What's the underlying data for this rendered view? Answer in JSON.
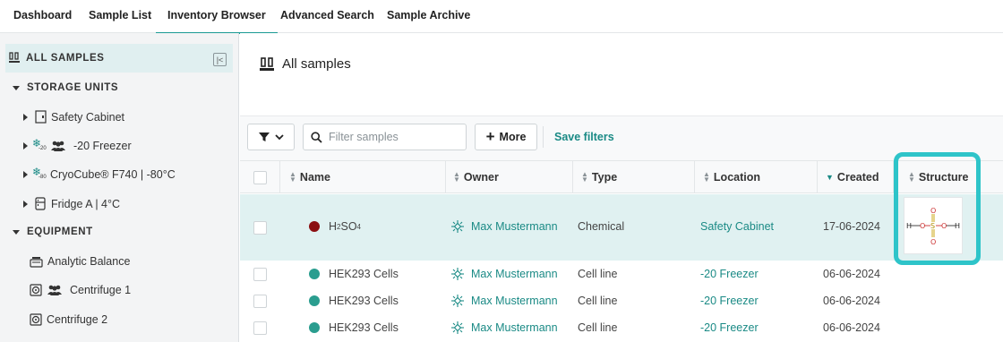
{
  "nav": {
    "tabs": [
      {
        "label": "Dashboard"
      },
      {
        "label": "Sample List"
      },
      {
        "label": "Inventory Browser",
        "active": true
      },
      {
        "label": "Advanced Search"
      },
      {
        "label": "Sample Archive"
      }
    ]
  },
  "sidebar": {
    "all_samples": "ALL SAMPLES",
    "storage_header": "STORAGE UNITS",
    "storage_units": [
      {
        "label": "Safety Cabinet",
        "icon": "cabinet-icon"
      },
      {
        "label": "-20 Freezer",
        "icon": "freezer-minus20-icon",
        "sub": "-20",
        "shared": true
      },
      {
        "label": "CryoCube® F740 | -80°C",
        "icon": "freezer-minus80-icon",
        "sub": "-80"
      },
      {
        "label": "Fridge A | 4°C",
        "icon": "fridge-icon"
      }
    ],
    "equipment_header": "EQUIPMENT",
    "equipment": [
      {
        "label": "Analytic Balance",
        "icon": "balance-icon"
      },
      {
        "label": "Centrifuge 1",
        "icon": "centrifuge-icon",
        "shared": true
      },
      {
        "label": "Centrifuge 2",
        "icon": "centrifuge-icon"
      }
    ]
  },
  "main": {
    "title": "All samples",
    "toolbar": {
      "search_placeholder": "Filter samples",
      "more_label": "More",
      "save_filters": "Save filters"
    },
    "columns": [
      "Name",
      "Owner",
      "Type",
      "Location",
      "Created",
      "Structure"
    ],
    "rows": [
      {
        "name_main": "H",
        "name_sub1": "2",
        "name_mid": "SO",
        "name_sub2": "4",
        "owner": "Max Mustermann",
        "type": "Chemical",
        "location": "Safety Cabinet",
        "created": "17-06-2024",
        "dot_color": "#8b0f12",
        "has_structure": true
      },
      {
        "name": "HEK293 Cells",
        "owner": "Max Mustermann",
        "type": "Cell line",
        "location": "-20 Freezer",
        "created": "06-06-2024",
        "dot_color": "#2a9d8f"
      },
      {
        "name": "HEK293 Cells",
        "owner": "Max Mustermann",
        "type": "Cell line",
        "location": "-20 Freezer",
        "created": "06-06-2024",
        "dot_color": "#2a9d8f"
      },
      {
        "name": "HEK293 Cells",
        "owner": "Max Mustermann",
        "type": "Cell line",
        "location": "-20 Freezer",
        "created": "06-06-2024",
        "dot_color": "#2a9d8f"
      }
    ],
    "structure_atoms": [
      "H",
      "O",
      "S",
      "O",
      "H",
      "O",
      "O"
    ]
  },
  "colors": {
    "accent": "#1a8a85",
    "highlight": "#2ec4c9",
    "selected_row": "#e0f1f1"
  }
}
